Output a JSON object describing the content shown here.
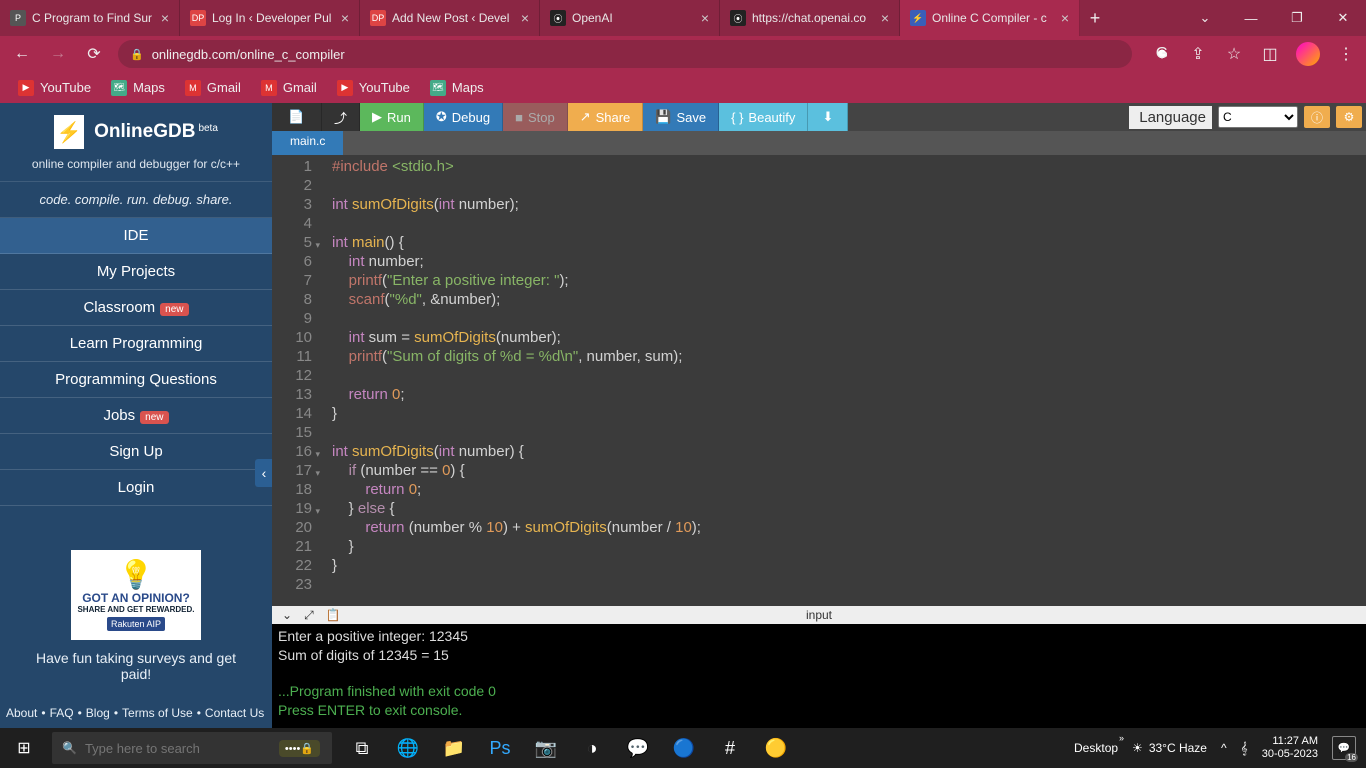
{
  "browser": {
    "tabs": [
      {
        "title": "C Program to Find Sur",
        "favicon": "P"
      },
      {
        "title": "Log In ‹ Developer Pul",
        "favicon": "DP"
      },
      {
        "title": "Add New Post ‹ Devel",
        "favicon": "DP"
      },
      {
        "title": "OpenAI",
        "favicon": "⦿"
      },
      {
        "title": "https://chat.openai.co",
        "favicon": "⦿"
      },
      {
        "title": "Online C Compiler - c",
        "favicon": "⚡",
        "active": true
      }
    ],
    "url": "onlinegdb.com/online_c_compiler",
    "bookmarks": [
      {
        "label": "YouTube",
        "icon": "▶"
      },
      {
        "label": "Maps",
        "icon": "🗺"
      },
      {
        "label": "Gmail",
        "icon": "M"
      },
      {
        "label": "Gmail",
        "icon": "M"
      },
      {
        "label": "YouTube",
        "icon": "▶"
      },
      {
        "label": "Maps",
        "icon": "🗺"
      }
    ]
  },
  "sidebar": {
    "brand": "OnlineGDB",
    "beta": "beta",
    "subtitle": "online compiler and debugger for c/c++",
    "tagline": "code. compile. run. debug. share.",
    "items": [
      {
        "label": "IDE",
        "active": true
      },
      {
        "label": "My Projects"
      },
      {
        "label": "Classroom",
        "badge": "new"
      },
      {
        "label": "Learn Programming"
      },
      {
        "label": "Programming Questions"
      },
      {
        "label": "Jobs",
        "badge": "new"
      },
      {
        "label": "Sign Up"
      },
      {
        "label": "Login"
      }
    ],
    "ad": {
      "head": "GOT AN OPINION?",
      "sub": "SHARE AND GET REWARDED.",
      "rak": "Rakuten AIP",
      "caption": "Have fun taking surveys and get paid!"
    },
    "footer": [
      "About",
      "•",
      "FAQ",
      "•",
      "Blog",
      "•",
      "Terms of Use",
      "•",
      "Contact Us"
    ]
  },
  "toolbar": {
    "run": "Run",
    "debug": "Debug",
    "stop": "Stop",
    "share": "Share",
    "save": "Save",
    "beautify": "Beautify",
    "language_label": "Language",
    "language_value": "C"
  },
  "file_tab": "main.c",
  "code": {
    "lines": 23
  },
  "console": {
    "header": "input",
    "line1": "Enter a positive integer: 12345",
    "line2": "Sum of digits of 12345 = 15",
    "line3": "...Program finished with exit code 0",
    "line4": "Press ENTER to exit console."
  },
  "taskbar": {
    "search_placeholder": "Type here to search",
    "desktop": "Desktop",
    "temp": "33°C Haze",
    "time": "11:27 AM",
    "date": "30-05-2023",
    "notif": "16"
  }
}
